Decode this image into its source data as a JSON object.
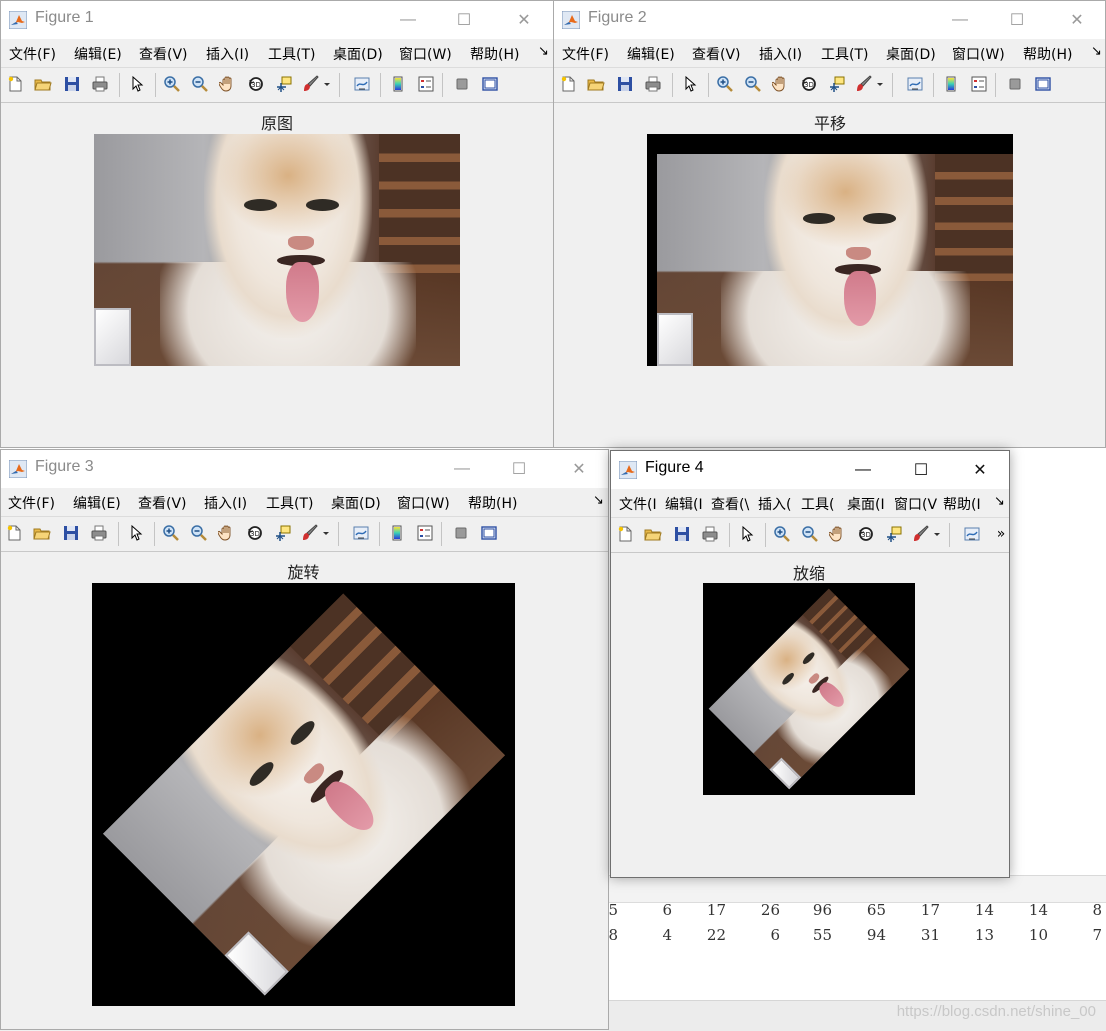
{
  "menu_labels": [
    "文件(F)",
    "编辑(E)",
    "查看(V)",
    "插入(I)",
    "工具(T)",
    "桌面(D)",
    "窗口(W)",
    "帮助(H)"
  ],
  "menu_labels_narrow": [
    "文件(I",
    "编辑(I",
    "查看(\\",
    "插入(",
    "工具(",
    "桌面(I",
    "窗口(V",
    "帮助(I"
  ],
  "menu_overflow": "↘",
  "toolbar_overflow": "»",
  "window_controls": {
    "minimize": "—",
    "maximize": "☐",
    "close": "✕"
  },
  "figures": [
    {
      "title": "Figure 1",
      "axes_title": "原图"
    },
    {
      "title": "Figure 2",
      "axes_title": "平移"
    },
    {
      "title": "Figure 3",
      "axes_title": "旋转"
    },
    {
      "title": "Figure 4",
      "axes_title": "放缩"
    }
  ],
  "command_window": {
    "rows": [
      [
        "5",
        "6",
        "17",
        "26",
        "96",
        "65",
        "17",
        "14",
        "14",
        "8"
      ],
      [
        "8",
        "4",
        "22",
        "6",
        "55",
        "94",
        "31",
        "13",
        "10",
        "7"
      ]
    ]
  },
  "watermark": "https://blog.csdn.net/shine_00"
}
